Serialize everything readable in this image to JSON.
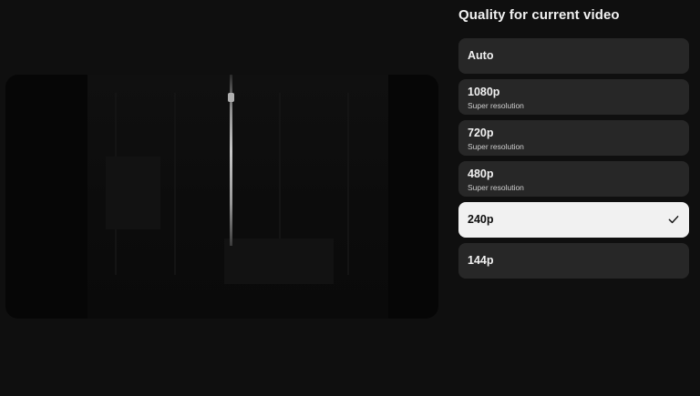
{
  "panel": {
    "title": "Quality for current video"
  },
  "options": [
    {
      "label": "Auto",
      "sublabel": "",
      "selected": false
    },
    {
      "label": "1080p",
      "sublabel": "Super resolution",
      "selected": false
    },
    {
      "label": "720p",
      "sublabel": "Super resolution",
      "selected": false
    },
    {
      "label": "480p",
      "sublabel": "Super resolution",
      "selected": false
    },
    {
      "label": "240p",
      "sublabel": "",
      "selected": true,
      "icon": "checkmark-icon"
    },
    {
      "label": "144p",
      "sublabel": "",
      "selected": false
    }
  ],
  "colors": {
    "background": "#0f0f0f",
    "option_bg": "#272727",
    "selected_bg": "#f1f1f1",
    "text": "#f1f1f1",
    "selected_text": "#0f0f0f"
  }
}
